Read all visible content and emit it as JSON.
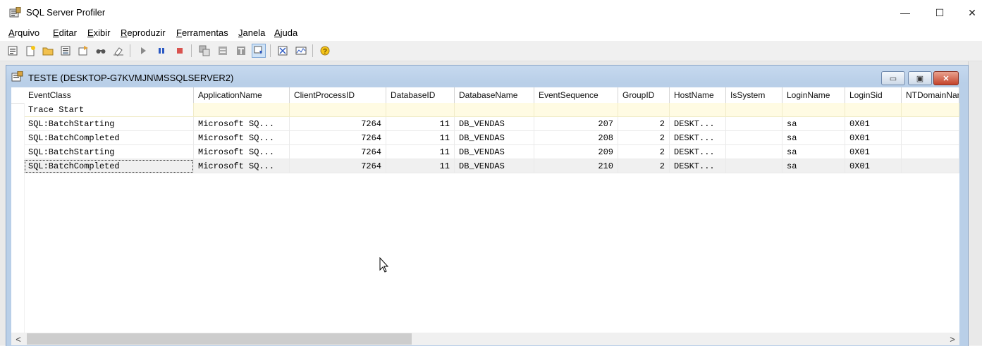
{
  "window": {
    "title": "SQL Server Profiler",
    "minimize_glyph": "—",
    "maximize_glyph": "☐",
    "close_glyph": "✕"
  },
  "menu": [
    {
      "accel": "A",
      "rest": "rquivo"
    },
    {
      "accel": "E",
      "rest": "ditar"
    },
    {
      "accel": "E",
      "rest": "xibir"
    },
    {
      "accel": "R",
      "rest": "eproduzir"
    },
    {
      "accel": "F",
      "rest": "erramentas"
    },
    {
      "accel": "J",
      "rest": "anela"
    },
    {
      "accel": "A",
      "rest": "juda"
    }
  ],
  "toolbar": {
    "icons": [
      "properties-icon",
      "new-trace-icon",
      "open-icon",
      "save-icon",
      "template-icon",
      "find-icon",
      "clear-icon",
      "run-icon",
      "pause-icon",
      "stop-icon",
      "group-icon",
      "ungroup-icon",
      "column-filter-icon",
      "autoscroll-icon",
      "import-icon",
      "perfmon-icon",
      "help-icon"
    ]
  },
  "trace_window": {
    "title": "TESTE (DESKTOP-G7KVMJN\\MSSQLSERVER2)",
    "columns": [
      "EventClass",
      "ApplicationName",
      "ClientProcessID",
      "DatabaseID",
      "DatabaseName",
      "EventSequence",
      "GroupID",
      "HostName",
      "IsSystem",
      "LoginName",
      "LoginSid",
      "NTDomainNar"
    ],
    "rows": [
      {
        "EventClass": "Trace Start",
        "ApplicationName": "",
        "ClientProcessID": "",
        "DatabaseID": "",
        "DatabaseName": "",
        "EventSequence": "",
        "GroupID": "",
        "HostName": "",
        "IsSystem": "",
        "LoginName": "",
        "LoginSid": "",
        "NTDomainNar": "",
        "kind": "trace"
      },
      {
        "EventClass": "SQL:BatchStarting",
        "ApplicationName": "Microsoft SQ...",
        "ClientProcessID": "7264",
        "DatabaseID": "11",
        "DatabaseName": "DB_VENDAS",
        "EventSequence": "207",
        "GroupID": "2",
        "HostName": "DESKT...",
        "IsSystem": "",
        "LoginName": "sa",
        "LoginSid": "0X01",
        "NTDomainNar": "",
        "kind": "normal"
      },
      {
        "EventClass": "SQL:BatchCompleted",
        "ApplicationName": "Microsoft SQ...",
        "ClientProcessID": "7264",
        "DatabaseID": "11",
        "DatabaseName": "DB_VENDAS",
        "EventSequence": "208",
        "GroupID": "2",
        "HostName": "DESKT...",
        "IsSystem": "",
        "LoginName": "sa",
        "LoginSid": "0X01",
        "NTDomainNar": "",
        "kind": "normal"
      },
      {
        "EventClass": "SQL:BatchStarting",
        "ApplicationName": "Microsoft SQ...",
        "ClientProcessID": "7264",
        "DatabaseID": "11",
        "DatabaseName": "DB_VENDAS",
        "EventSequence": "209",
        "GroupID": "2",
        "HostName": "DESKT...",
        "IsSystem": "",
        "LoginName": "sa",
        "LoginSid": "0X01",
        "NTDomainNar": "",
        "kind": "normal"
      },
      {
        "EventClass": "SQL:BatchCompleted",
        "ApplicationName": "Microsoft SQ...",
        "ClientProcessID": "7264",
        "DatabaseID": "11",
        "DatabaseName": "DB_VENDAS",
        "EventSequence": "210",
        "GroupID": "2",
        "HostName": "DESKT...",
        "IsSystem": "",
        "LoginName": "sa",
        "LoginSid": "0X01",
        "NTDomainNar": "",
        "kind": "selected"
      }
    ]
  },
  "scroll": {
    "left_arrow": "<",
    "right_arrow": ">"
  },
  "colors": {
    "accent": "#b9cfe8",
    "trace_row": "#fffbe3",
    "close_button": "#c4432b"
  }
}
